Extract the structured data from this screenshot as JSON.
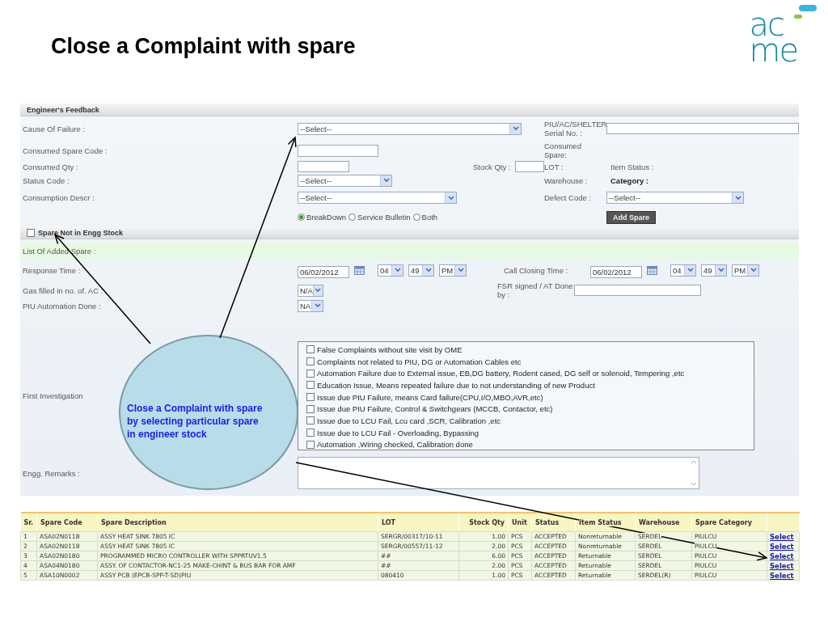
{
  "slide_title": "Close a Complaint with spare",
  "logo": {
    "top": "ac",
    "bottom": "me"
  },
  "form": {
    "header": "Engineer's Feedback",
    "cause_of_failure": {
      "label": "Cause Of Failure :",
      "value": "--Select--"
    },
    "serial_no": {
      "label": "PIU/AC/SHELTER Serial No. :"
    },
    "consumed_spare_code": {
      "label": "Consumed Spare  Code :"
    },
    "consumed_spare": {
      "label": "Consumed Spare:"
    },
    "consumed_qty": {
      "label": "Consumed Qty :"
    },
    "stock_qty": {
      "label": "Stock  Qty :"
    },
    "lot": {
      "label": "LOT :"
    },
    "item_status": {
      "label": "Item Status :"
    },
    "status_code": {
      "label": "Status Code :",
      "value": "--Select--"
    },
    "warehouse": {
      "label": "Warehouse :"
    },
    "category": {
      "label": "Category :"
    },
    "consumption_descr": {
      "label": "Consumption Descr :",
      "value": "--Select--"
    },
    "defect_code": {
      "label": "Defect Code :",
      "value": "--Select--"
    },
    "spare_types": [
      {
        "label": "BreakDown",
        "selected": true
      },
      {
        "label": "Service Bulletin",
        "selected": false
      },
      {
        "label": "Both",
        "selected": false
      }
    ],
    "add_spare_button": "Add Spare",
    "spare_not_in_stock": {
      "label": "Spare Not in Engg Stock",
      "checked": false
    },
    "list_of_added_spare": "List Of Added Spare :",
    "response_time": {
      "label": "Response Time :",
      "date": "06/02/2012",
      "hour": "04",
      "minute": "49",
      "ampm": "PM"
    },
    "call_closing_time": {
      "label": "Call Closing Time :",
      "date": "06/02/2012",
      "hour": "04",
      "minute": "49",
      "ampm": "PM"
    },
    "gas_filled": {
      "label": "Gas filled in no. of. AC :",
      "value": "N/A"
    },
    "fsr_signed": {
      "label": "FSR signed / AT Done by :"
    },
    "piu_automation": {
      "label": "PIU Automation Done :",
      "value": "NA"
    },
    "first_investigation": {
      "label": "First Investigation",
      "options": [
        {
          "label": "False Complaints without site visit by OME",
          "checked": false
        },
        {
          "label": "Complaints not related to PIU, DG or Automation Cables etc",
          "checked": false
        },
        {
          "label": "Automation Failure due to External issue, EB,DG battery, Rodent cased, DG self or solenoid, Tempering ,etc",
          "checked": false
        },
        {
          "label": "Education Issue, Means repeated failure due to not understanding of new Product",
          "checked": false
        },
        {
          "label": "Issue due PIU Failure, means Card failure(CPU,I/O,MBO,AVR,etc)",
          "checked": false
        },
        {
          "label": "Issue due PIU Failure, Control & Switchgears (MCCB, Contactor, etc)",
          "checked": false
        },
        {
          "label": "Issue due to LCU Fail, Lcu card ,SCR, Calibration ,etc",
          "checked": false
        },
        {
          "label": "Issue due to LCU Fail - Overloading, Bypassing",
          "checked": false
        },
        {
          "label": "Automation ,Wiring checked, Calibration done",
          "checked": false
        }
      ]
    },
    "engg_remarks": {
      "label": "Engg. Remarks :"
    }
  },
  "table": {
    "columns": [
      "Sr.",
      "Spare Code",
      "Spare Description",
      "LOT",
      "Stock Qty",
      "Unit",
      "Status",
      "Item Status",
      "Warehouse",
      "Spare Category"
    ],
    "rows": [
      {
        "cells": [
          "1",
          "ASA02N0118",
          "ASSY HEAT SINK 7805 IC",
          "SERGR/00317/10-11",
          "1.00",
          "PCS",
          "ACCEPTED",
          "Nonreturnable",
          "SERDEL",
          "PIULCU"
        ],
        "link": "Select"
      },
      {
        "cells": [
          "2",
          "ASA02N0118",
          "ASSY HEAT SINK 7805 IC",
          "SERGR/00557/11-12",
          "2.00",
          "PCS",
          "ACCEPTED",
          "Nonreturnable",
          "SERDEL",
          "PIULCU"
        ],
        "link": "Select"
      },
      {
        "cells": [
          "3",
          "ASA02N0180",
          "PROGRAMMED MICRO CONTROLLER WITH SPPRTUV1.5",
          "##",
          "6.00",
          "PCS",
          "ACCEPTED",
          "Returnable",
          "SERDEL",
          "PIULCU"
        ],
        "link": "Select"
      },
      {
        "cells": [
          "4",
          "ASA04N0180",
          "ASSY. OF CONTACTOR-NC1-25 MAKE-CHINT & BUS BAR  FOR AMF",
          "##",
          "2.00",
          "PCS",
          "ACCEPTED",
          "Returnable",
          "SERDEL",
          "PIULCU"
        ],
        "link": "Select"
      },
      {
        "cells": [
          "5",
          "ASA10N0002",
          "ASSY PCB (EPCB-SPP-T-SD)PIU",
          "080410",
          "1.00",
          "PCS",
          "ACCEPTED",
          "Returnable",
          "SERDEL(R)",
          "PIULCU"
        ],
        "link": "Select"
      }
    ]
  },
  "callout": "Close a Complaint with spare by selecting particular spare in engineer stock"
}
